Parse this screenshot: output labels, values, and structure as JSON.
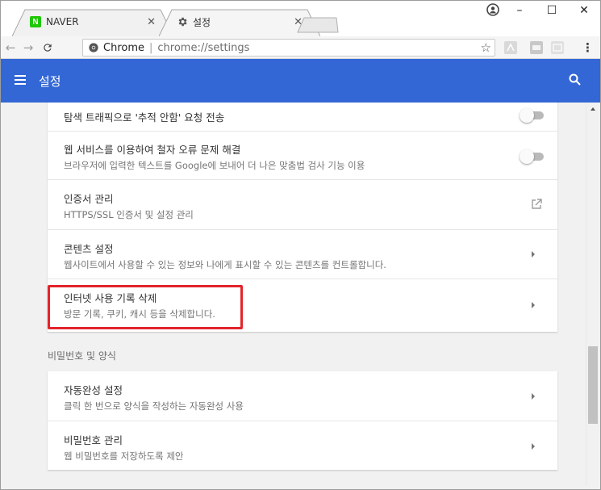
{
  "tabs": [
    {
      "label": "NAVER",
      "favicon": "naver-icon",
      "favicon_letter": "N",
      "active": false
    },
    {
      "label": "설정",
      "favicon": "gear-icon",
      "active": true
    }
  ],
  "window_controls": {
    "minimize": "–",
    "maximize": "☐",
    "close": "✕"
  },
  "toolbar": {
    "omnibox_label": "Chrome",
    "omnibox_separator": "|",
    "url": "chrome://settings"
  },
  "appbar": {
    "title": "설정",
    "color": "#3367d6"
  },
  "privacy_rows": [
    {
      "title": "탐색 트래픽으로 '추적 안함' 요청 전송",
      "subtitle": "",
      "control": "toggle",
      "enabled": false
    },
    {
      "title": "웹 서비스를 이용하여 철자 오류 문제 해결",
      "subtitle": "브라우저에 입력한 텍스트를 Google에 보내어 더 나은 맞춤법 검사 기능 이용",
      "control": "toggle",
      "enabled": false
    },
    {
      "title": "인증서 관리",
      "subtitle": "HTTPS/SSL 인증서 및 설정 관리",
      "control": "external-link"
    },
    {
      "title": "콘텐츠 설정",
      "subtitle": "웹사이트에서 사용할 수 있는 정보와 나에게 표시할 수 있는 콘텐츠를 컨트롤합니다.",
      "control": "chevron"
    },
    {
      "title": "인터넷 사용 기록 삭제",
      "subtitle": "방문 기록, 쿠키, 캐시 등을 삭제합니다.",
      "control": "chevron",
      "highlighted": true
    }
  ],
  "section_passwords": {
    "label": "비밀번호 및 양식",
    "rows": [
      {
        "title": "자동완성 설정",
        "subtitle": "클릭 한 번으로 양식을 작성하는 자동완성 사용",
        "control": "chevron"
      },
      {
        "title": "비밀번호 관리",
        "subtitle": "웹 비밀번호를 저장하도록 제안",
        "control": "chevron"
      }
    ]
  },
  "highlight_color": "#e3242b"
}
